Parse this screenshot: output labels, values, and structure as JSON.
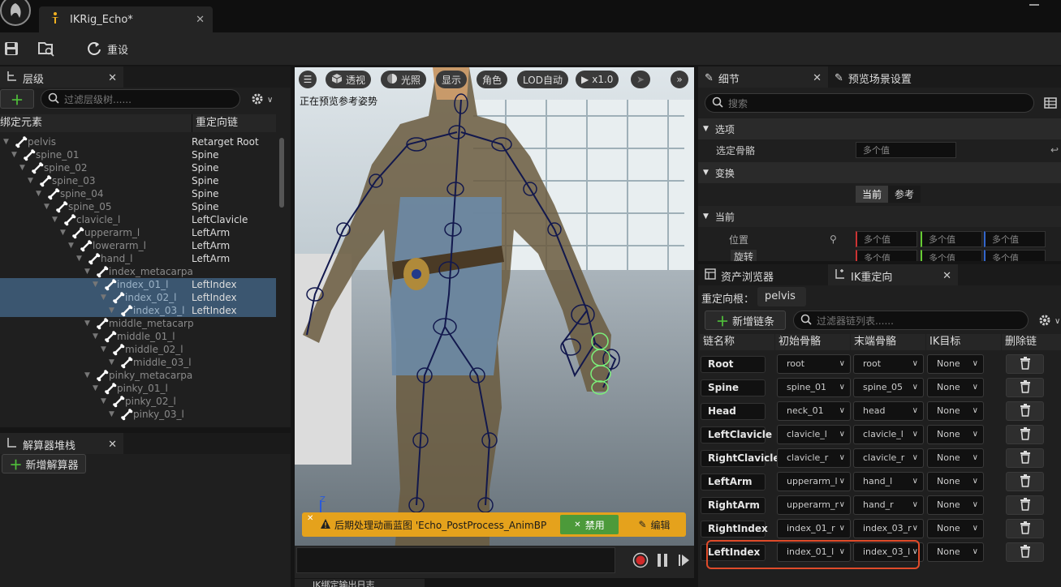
{
  "window": {
    "asset_tab": "IKRig_Echo*",
    "save_icon": "save-icon",
    "browse_icon": "browse-icon"
  },
  "toolbar": {
    "reset_label": "重设"
  },
  "hierarchy": {
    "tab_title": "层级",
    "search_placeholder": "过滤层级树......",
    "col_element": "绑定元素",
    "col_chain": "重定向链",
    "rows": [
      {
        "name": "pelvis",
        "chain": "Retarget Root",
        "indent": 0,
        "sel": false
      },
      {
        "name": "spine_01",
        "chain": "Spine",
        "indent": 1,
        "sel": false
      },
      {
        "name": "spine_02",
        "chain": "Spine",
        "indent": 2,
        "sel": false
      },
      {
        "name": "spine_03",
        "chain": "Spine",
        "indent": 3,
        "sel": false
      },
      {
        "name": "spine_04",
        "chain": "Spine",
        "indent": 4,
        "sel": false
      },
      {
        "name": "spine_05",
        "chain": "Spine",
        "indent": 5,
        "sel": false
      },
      {
        "name": "clavicle_l",
        "chain": "LeftClavicle",
        "indent": 6,
        "sel": false
      },
      {
        "name": "upperarm_l",
        "chain": "LeftArm",
        "indent": 7,
        "sel": false
      },
      {
        "name": "lowerarm_l",
        "chain": "LeftArm",
        "indent": 8,
        "sel": false
      },
      {
        "name": "hand_l",
        "chain": "LeftArm",
        "indent": 9,
        "sel": false
      },
      {
        "name": "index_metacarpa",
        "chain": "",
        "indent": 10,
        "sel": false
      },
      {
        "name": "index_01_l",
        "chain": "LeftIndex",
        "indent": 11,
        "sel": true
      },
      {
        "name": "index_02_l",
        "chain": "LeftIndex",
        "indent": 12,
        "sel": true
      },
      {
        "name": "index_03_l",
        "chain": "LeftIndex",
        "indent": 13,
        "sel": true
      },
      {
        "name": "middle_metacarp",
        "chain": "",
        "indent": 10,
        "sel": false
      },
      {
        "name": "middle_01_l",
        "chain": "",
        "indent": 11,
        "sel": false
      },
      {
        "name": "middle_02_l",
        "chain": "",
        "indent": 12,
        "sel": false
      },
      {
        "name": "middle_03_l",
        "chain": "",
        "indent": 13,
        "sel": false
      },
      {
        "name": "pinky_metacarpa",
        "chain": "",
        "indent": 10,
        "sel": false
      },
      {
        "name": "pinky_01_l",
        "chain": "",
        "indent": 11,
        "sel": false
      },
      {
        "name": "pinky_02_l",
        "chain": "",
        "indent": 12,
        "sel": false
      },
      {
        "name": "pinky_03_l",
        "chain": "",
        "indent": 13,
        "sel": false
      }
    ]
  },
  "solver": {
    "tab_title": "解算器堆栈",
    "add_label": "新增解算器"
  },
  "viewport": {
    "perspective": "透视",
    "lighting": "光照",
    "show": "显示",
    "angle": "角色",
    "lod": "LOD自动",
    "speed": "x1.0",
    "status": "正在预览参考姿势",
    "axis_z": "Z",
    "warning_text": "后期处理动画蓝图 'Echo_PostProcess_AnimBP",
    "disable_label": "禁用",
    "edit_label": "编辑"
  },
  "details": {
    "tab_title": "细节",
    "tab2_title": "预览场景设置",
    "search_placeholder": "搜索",
    "section_options": "选项",
    "selected_bones_label": "选定骨骼",
    "multi_value": "多个值",
    "section_transform": "变换",
    "current_btn": "当前",
    "reference_btn": "参考",
    "section_current": "当前",
    "position_label": "位置",
    "rotation_label": "旋转"
  },
  "ik_panel": {
    "tab1_title": "资产浏览器",
    "tab2_title": "IK重定向",
    "root_label": "重定向根：",
    "root_value": "pelvis",
    "add_chain_label": "新增链条",
    "filter_placeholder": "过滤器链列表......",
    "col_name": "链名称",
    "col_start": "初始骨骼",
    "col_end": "末端骨骼",
    "col_goal": "IK目标",
    "col_delete": "删除链",
    "chains": [
      {
        "name": "Root",
        "start": "root",
        "end": "root",
        "goal": "None"
      },
      {
        "name": "Spine",
        "start": "spine_01",
        "end": "spine_05",
        "goal": "None"
      },
      {
        "name": "Head",
        "start": "neck_01",
        "end": "head",
        "goal": "None"
      },
      {
        "name": "LeftClavicle",
        "start": "clavicle_l",
        "end": "clavicle_l",
        "goal": "None"
      },
      {
        "name": "RightClavicle",
        "start": "clavicle_r",
        "end": "clavicle_r",
        "goal": "None"
      },
      {
        "name": "LeftArm",
        "start": "upperarm_l",
        "end": "hand_l",
        "goal": "None"
      },
      {
        "name": "RightArm",
        "start": "upperarm_r",
        "end": "hand_r",
        "goal": "None"
      },
      {
        "name": "RightIndex",
        "start": "index_01_r",
        "end": "index_03_r",
        "goal": "None"
      },
      {
        "name": "LeftIndex",
        "start": "index_01_l",
        "end": "index_03_l",
        "goal": "None"
      }
    ]
  },
  "log_tab": {
    "title": "IK绑定输出日志"
  },
  "colors": {
    "accent_green": "#4fbf3a",
    "selection": "#3b5670",
    "warning": "#e5a21c",
    "highlight": "#e04b2a"
  }
}
